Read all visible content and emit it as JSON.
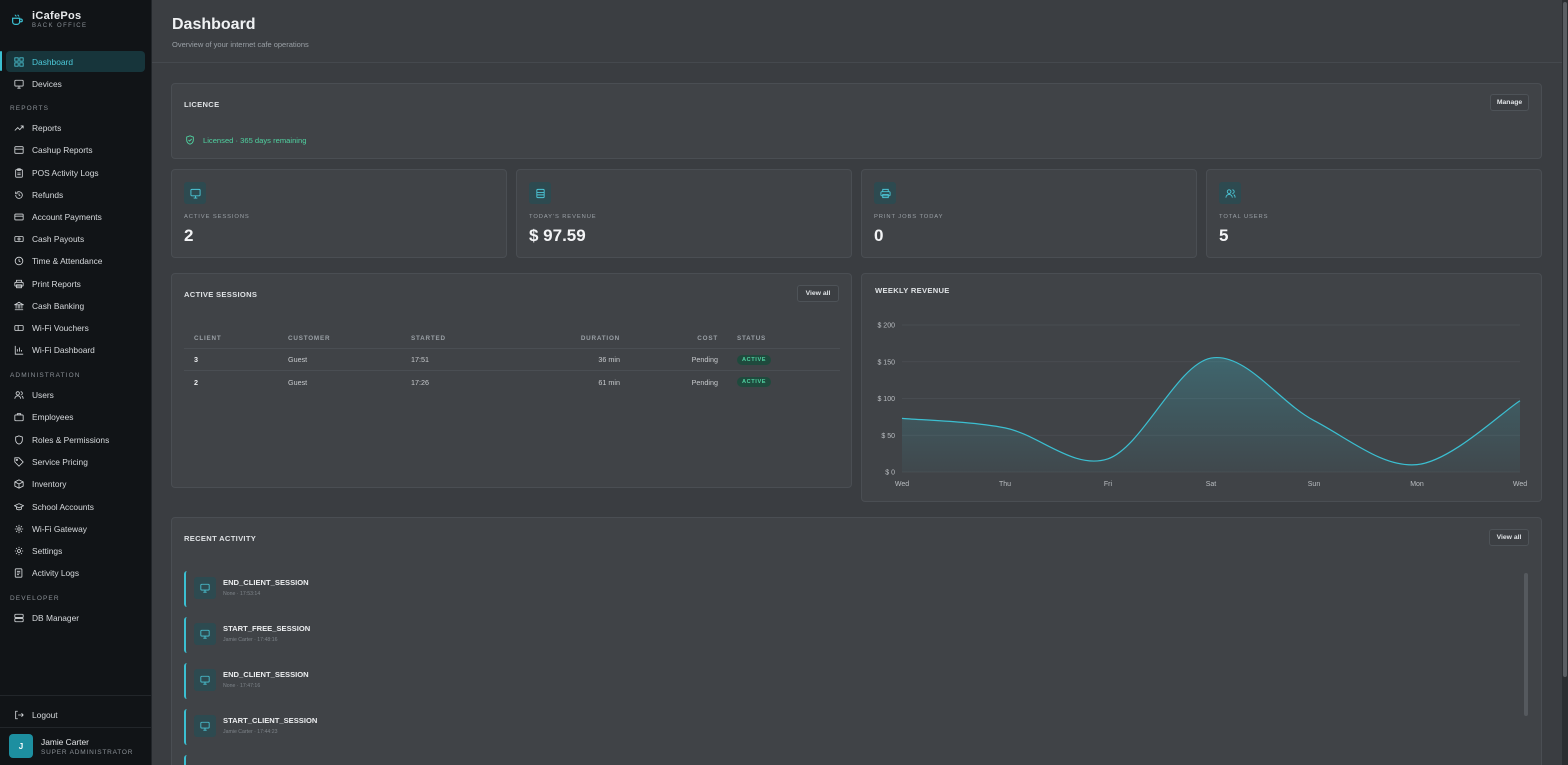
{
  "app": {
    "name": "iCafePos",
    "subtitle": "BACK OFFICE"
  },
  "sidebar": {
    "dashboard": "Dashboard",
    "devices": "Devices",
    "reports_label": "REPORTS",
    "reports": [
      "Reports",
      "Cashup Reports",
      "POS Activity Logs",
      "Refunds",
      "Account Payments",
      "Cash Payouts",
      "Time & Attendance",
      "Print Reports",
      "Cash Banking",
      "Wi-Fi Vouchers",
      "Wi-Fi Dashboard"
    ],
    "admin_label": "ADMINISTRATION",
    "admin": [
      "Users",
      "Employees",
      "Roles & Permissions",
      "Service Pricing",
      "Inventory",
      "School Accounts",
      "Wi-Fi Gateway",
      "Settings",
      "Activity Logs"
    ],
    "developer_label": "DEVELOPER",
    "developer": [
      "DB Manager"
    ],
    "logout": "Logout",
    "user": {
      "initial": "J",
      "name": "Jamie Carter",
      "role": "SUPER ADMINISTRATOR"
    }
  },
  "header": {
    "title": "Dashboard",
    "subtitle": "Overview of your internet cafe operations"
  },
  "licence": {
    "title": "LICENCE",
    "manage": "Manage",
    "status": "Licensed · 365 days remaining",
    "status_color": "#4fd1a0"
  },
  "stats": [
    {
      "label": "ACTIVE SESSIONS",
      "value": "2",
      "icon": "monitor-icon"
    },
    {
      "label": "TODAY'S REVENUE",
      "value": "$ 97.59",
      "icon": "wallet-icon"
    },
    {
      "label": "PRINT JOBS TODAY",
      "value": "0",
      "icon": "printer-icon"
    },
    {
      "label": "TOTAL USERS",
      "value": "5",
      "icon": "users-icon"
    }
  ],
  "sessions": {
    "title": "ACTIVE SESSIONS",
    "view_all": "View all",
    "columns": [
      "CLIENT",
      "CUSTOMER",
      "STARTED",
      "DURATION",
      "COST",
      "STATUS"
    ],
    "rows": [
      {
        "client": "3",
        "customer": "Guest",
        "started": "17:51",
        "duration": "36 min",
        "cost": "Pending",
        "status": "ACTIVE"
      },
      {
        "client": "2",
        "customer": "Guest",
        "started": "17:26",
        "duration": "61 min",
        "cost": "Pending",
        "status": "ACTIVE"
      }
    ]
  },
  "revenue": {
    "title": "WEEKLY REVENUE"
  },
  "chart_data": {
    "type": "area",
    "title": "WEEKLY REVENUE",
    "x": [
      "Wed",
      "Thu",
      "Fri",
      "Sat",
      "Sun",
      "Mon",
      "Wed"
    ],
    "series": [
      {
        "values": [
          73,
          60,
          18,
          155,
          70,
          10,
          97
        ]
      }
    ],
    "ylim": [
      0,
      200
    ],
    "yticks": [
      "$ 0",
      "$ 50",
      "$ 100",
      "$ 150",
      "$ 200"
    ],
    "grid": true,
    "color": "#3bbfd1"
  },
  "activity": {
    "title": "RECENT ACTIVITY",
    "view_all": "View all",
    "items": [
      {
        "title": "END_CLIENT_SESSION",
        "meta": "None · 17:53:14"
      },
      {
        "title": "START_FREE_SESSION",
        "meta": "Jamie Carter · 17:48:16"
      },
      {
        "title": "END_CLIENT_SESSION",
        "meta": "None · 17:47:16"
      },
      {
        "title": "START_CLIENT_SESSION",
        "meta": "Jamie Carter · 17:44:23"
      }
    ]
  },
  "colors": {
    "accent": "#3bbfd1",
    "success": "#4fd1a0",
    "background": "#3a3d41",
    "sidebar": "#111417"
  }
}
